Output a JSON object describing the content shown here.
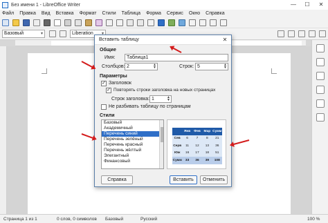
{
  "window": {
    "title": "Без имени 1 - LibreOffice Writer",
    "controls": [
      "—",
      "☐",
      "✕"
    ]
  },
  "menu": [
    "Файл",
    "Правка",
    "Вид",
    "Вставка",
    "Формат",
    "Стили",
    "Таблица",
    "Форма",
    "Сервис",
    "Окно",
    "Справка"
  ],
  "toolbar": {
    "style_value": "Базовый",
    "font_value": "Liberation"
  },
  "dialog": {
    "title": "Вставить таблицу",
    "close": "✕",
    "general": {
      "heading": "Общие",
      "name_label": "Имя:",
      "name_value": "Таблица1",
      "columns_label": "Столбцов:",
      "columns_value": "2",
      "rows_label": "Строк:",
      "rows_value": "5"
    },
    "params": {
      "heading": "Параметры",
      "heading_row": {
        "label": "Заголовок",
        "checked": "✓"
      },
      "repeat_heading": {
        "label": "Повторять строки заголовка на новых страницах",
        "checked": "✓"
      },
      "heading_rows_label": "Строк заголовка:",
      "heading_rows_value": "1",
      "no_split": {
        "label": "Не разбивать таблицу по страницам",
        "checked": ""
      }
    },
    "styles": {
      "heading": "Стили",
      "items": [
        "Базовый",
        "Академичный",
        "Перечень синий",
        "Перечень зелёный",
        "Перечень красный",
        "Перечень жёлтый",
        "Элегантный",
        "Финансовый"
      ],
      "selected_index": 2
    },
    "preview": {
      "header": [
        "",
        "Янв",
        "Фев",
        "Мар",
        "Сумм"
      ],
      "rows": [
        [
          "Сев",
          "6",
          "7",
          "8",
          "21"
        ],
        [
          "Серв",
          "11",
          "12",
          "13",
          "36"
        ],
        [
          "Юж",
          "16",
          "17",
          "18",
          "51"
        ]
      ],
      "total": [
        "Сумм",
        "33",
        "36",
        "39",
        "108"
      ]
    },
    "buttons": {
      "help": "Справка",
      "insert": "Вставить",
      "cancel": "Отменить"
    }
  },
  "status": {
    "page": "Страница 1 из 1",
    "words": "0 слов, 0 символов",
    "style": "Базовый",
    "language": "Русский",
    "zoom": "100 %"
  },
  "colors": {
    "accent": "#2f6fc7",
    "arrow": "#d41c1c",
    "preview_header": "#1f5aa8"
  }
}
